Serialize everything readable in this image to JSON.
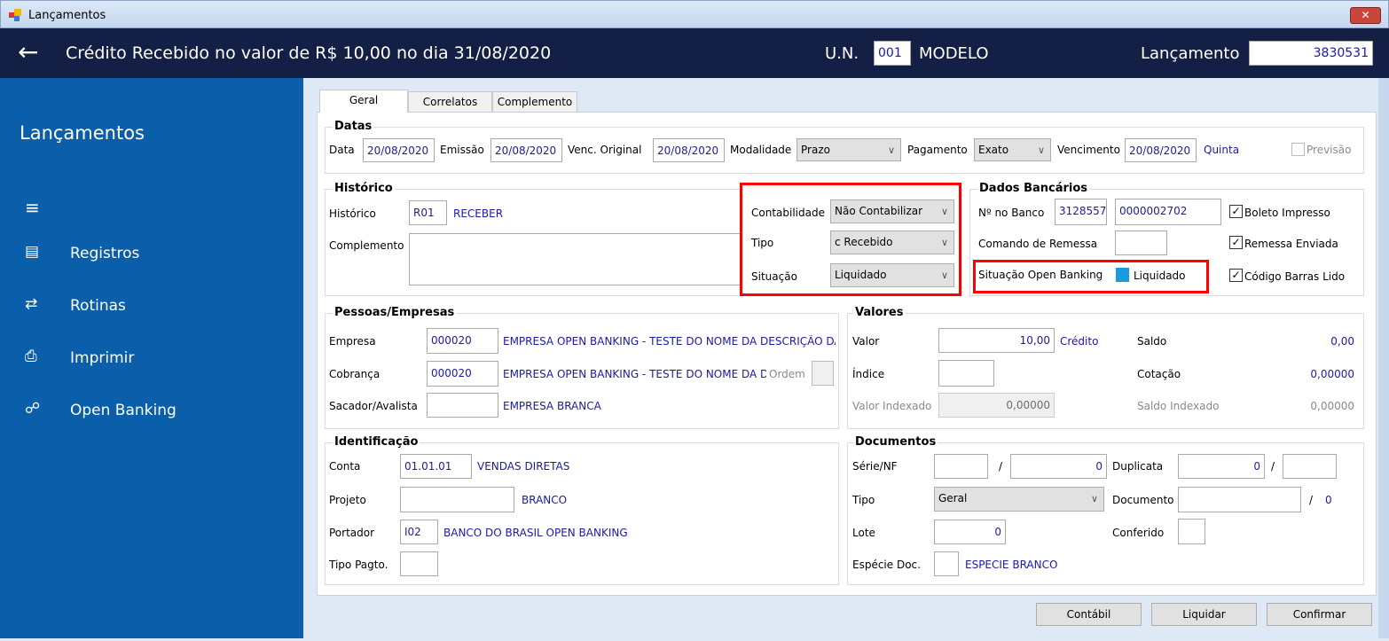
{
  "window": {
    "title": "Lançamentos",
    "close": "✕"
  },
  "header": {
    "title": "Crédito Recebido no valor de R$ 10,00 no dia 31/08/2020",
    "un_label": "U.N.",
    "un_value": "001",
    "un_name": "MODELO",
    "lanc_label": "Lançamento",
    "lanc_value": "3830531"
  },
  "sidebar": {
    "title": "Lançamentos",
    "items": [
      {
        "label": "Registros"
      },
      {
        "label": "Rotinas"
      },
      {
        "label": "Imprimir"
      },
      {
        "label": "Open Banking"
      }
    ]
  },
  "tabs": [
    "Geral",
    "Correlatos",
    "Complemento"
  ],
  "datas": {
    "title": "Datas",
    "data_label": "Data",
    "data": "20/08/2020",
    "emissao_label": "Emissão",
    "emissao": "20/08/2020",
    "venc_orig_label": "Venc. Original",
    "venc_orig": "20/08/2020",
    "modalidade_label": "Modalidade",
    "modalidade": "Prazo",
    "pagamento_label": "Pagamento",
    "pagamento": "Exato",
    "vencimento_label": "Vencimento",
    "vencimento": "20/08/2020",
    "dia": "Quinta",
    "previsao": "Previsão"
  },
  "historico": {
    "title": "Histórico",
    "hist_label": "Histórico",
    "hist_code": "R01",
    "hist_name": "RECEBER",
    "complemento_label": "Complemento",
    "complemento": "",
    "contab_label": "Contabilidade",
    "contab": "Não Contabilizar",
    "tipo_label": "Tipo",
    "tipo": "c Recebido",
    "situacao_label": "Situação",
    "situacao": "Liquidado"
  },
  "banco": {
    "title": "Dados Bancários",
    "nro_label": "Nº no Banco",
    "nro1": "3128557",
    "nro2": "0000002702",
    "comando_label": "Comando de Remessa",
    "comando": "",
    "ob_label": "Situação Open Banking",
    "ob_value": "Liquidado",
    "ob_color": "#1a9be0",
    "boleto": "Boleto Impresso",
    "remessa": "Remessa Enviada",
    "codigo": "Código Barras Lido",
    "check": "✓"
  },
  "pessoas": {
    "title": "Pessoas/Empresas",
    "empresa_label": "Empresa",
    "empresa_code": "000020",
    "empresa_name": "EMPRESA OPEN BANKING - TESTE DO NOME DA DESCRIÇÃO DA EMPRESA",
    "cobranca_label": "Cobrança",
    "cobranca_code": "000020",
    "cobranca_name": "EMPRESA OPEN BANKING - TESTE DO NOME DA DESCRIÇÃO DA EMPRESA",
    "ordem_label": "Ordem",
    "sacador_label": "Sacador/Avalista",
    "sacador_code": "",
    "sacador_name": "EMPRESA BRANCA"
  },
  "valores": {
    "title": "Valores",
    "valor_label": "Valor",
    "valor": "10,00",
    "valor_tipo": "Crédito",
    "saldo_label": "Saldo",
    "saldo": "0,00",
    "indice_label": "Índice",
    "indice": "",
    "cotacao_label": "Cotação",
    "cotacao": "0,00000",
    "vi_label": "Valor Indexado",
    "vi": "0,00000",
    "si_label": "Saldo Indexado",
    "si": "0,00000"
  },
  "ident": {
    "title": "Identificação",
    "conta_label": "Conta",
    "conta": "01.01.01",
    "conta_name": "VENDAS DIRETAS",
    "projeto_label": "Projeto",
    "projeto": "",
    "projeto_name": "BRANCO",
    "portador_label": "Portador",
    "portador": "I02",
    "portador_name": "BANCO DO BRASIL OPEN BANKING",
    "tipopag_label": "Tipo Pagto.",
    "tipopag": ""
  },
  "docs": {
    "title": "Documentos",
    "serie_label": "Série/NF",
    "serie": "",
    "slash": "/",
    "nf": "0",
    "dup_label": "Duplicata",
    "dup": "0",
    "dup2": "",
    "tipo_label": "Tipo",
    "tipo": "Geral",
    "doc_label": "Documento",
    "doc": "",
    "doc_num": "0",
    "lote_label": "Lote",
    "lote": "0",
    "conf_label": "Conferido",
    "conf": "",
    "especie_label": "Espécie Doc.",
    "especie": "",
    "especie_name": "ESPECIE BRANCO"
  },
  "buttons": {
    "contabil": "Contábil",
    "liquidar": "Liquidar",
    "confirmar": "Confirmar"
  }
}
